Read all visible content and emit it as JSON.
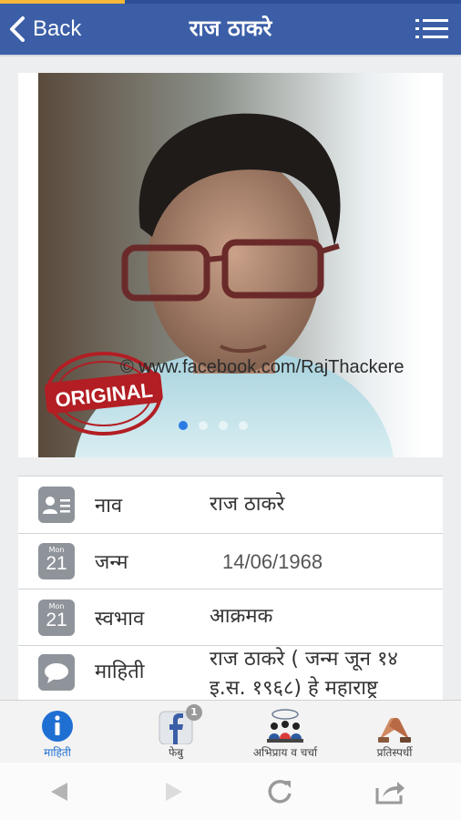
{
  "progress": {
    "fraction": 0.27,
    "color": "#f6b83a"
  },
  "topbar": {
    "back_label": "Back",
    "title": "राज ठाकरे",
    "menu_icon": "list-menu-icon",
    "background": "#3b5ea7"
  },
  "gallery": {
    "watermark": "© www.facebook.com/RajThackere",
    "stamp_text": "ORIGINAL",
    "slides": 4,
    "active_slide": 0
  },
  "profile": {
    "rows": [
      {
        "icon": "contact-card-icon",
        "label": "नाव",
        "value": "राज ठाकरे"
      },
      {
        "icon": "calendar-icon",
        "cal_month": "Mon",
        "cal_day": "21",
        "label": "जन्म",
        "value": "14/06/1968"
      },
      {
        "icon": "calendar-icon",
        "cal_month": "Mon",
        "cal_day": "21",
        "label": "स्वभाव",
        "value": "आक्रमक"
      },
      {
        "icon": "speech-bubble-icon",
        "label": "माहिती",
        "value": "राज ठाकरे ( जन्म जून १४ इ.स. १९६८) हे महाराष्ट्र"
      }
    ]
  },
  "tabs": [
    {
      "icon": "info-icon",
      "label": "माहिती",
      "active": true
    },
    {
      "icon": "facebook-icon",
      "label": "फेबु",
      "badge": "1"
    },
    {
      "icon": "people-chat-icon",
      "label": "अभिप्राय व चर्चा"
    },
    {
      "icon": "handshake-icon",
      "label": "प्रतिस्पर्धी"
    }
  ],
  "browser_nav": [
    "back-arrow-icon",
    "forward-arrow-icon",
    "refresh-icon",
    "share-icon"
  ],
  "accent": "#1f6fd3"
}
